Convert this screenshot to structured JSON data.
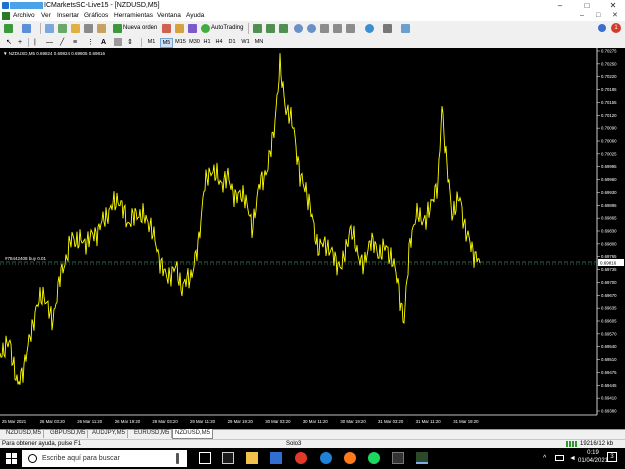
{
  "window": {
    "title": "ICMarketsSC-Live15 - [NZDUSD,M5]",
    "minimize_glyph": "–",
    "restore_glyph": "□",
    "close_glyph": "✕"
  },
  "menu": {
    "items": [
      "Archivo",
      "Ver",
      "Insertar",
      "Gráficos",
      "Herramientas",
      "Ventana",
      "Ayuda"
    ],
    "doc_controls": [
      "–",
      "□",
      "✕"
    ]
  },
  "toolbar": {
    "new_order_label": "Nueva orden",
    "autotrading_label": "AutoTrading",
    "alerts_count": "1"
  },
  "timeframes": [
    "M1",
    "M5",
    "M15",
    "M30",
    "H1",
    "H4",
    "D1",
    "W1",
    "MN"
  ],
  "chart": {
    "info_header": "▼ NZDUSD,M5  0.69824 0.69824 0.69805 0.69816",
    "order_label": "#78442408 buy 0.01",
    "current_price": "0.69816",
    "price_labels": [
      "0.70275",
      "0.70250",
      "0.70220",
      "0.70185",
      "0.70155",
      "0.70120",
      "0.70090",
      "0.70060",
      "0.70025",
      "0.69995",
      "0.69960",
      "0.69930",
      "0.69895",
      "0.69865",
      "0.69830",
      "0.69800",
      "0.69765",
      "0.69735",
      "0.69700",
      "0.69670",
      "0.69635",
      "0.69605",
      "0.69570",
      "0.69540",
      "0.69510",
      "0.69475",
      "0.69445",
      "0.69410",
      "0.69380"
    ],
    "time_labels": [
      "25 Mar 2021",
      "26 Mar 03:20",
      "26 Mar 11:20",
      "26 Mar 19:20",
      "29 Mar 03:20",
      "29 Mar 11:20",
      "29 Mar 19:20",
      "30 Mar 03:20",
      "30 Mar 11:20",
      "30 Mar 19:20",
      "31 Mar 03:20",
      "31 Mar 11:20",
      "31 Mar 19:20"
    ],
    "colors": {
      "background": "#000000",
      "candles": "#ffff00",
      "order_line": "#2e8b57",
      "bid_line": "#cccccc"
    }
  },
  "tabs": [
    "NZDUSD,M5",
    "GBPUSD,M5",
    "AUDJPY,M5",
    "EURUSD,M5",
    "NZDUSD,M5"
  ],
  "active_tab_index": 4,
  "status": {
    "help": "Para obtener ayuda, pulse F1",
    "profile": "Solo3",
    "traffic": "19216/12 kb"
  },
  "taskbar": {
    "search_placeholder": "Escribe aquí para buscar",
    "time": "0:19",
    "date": "01/04/2021",
    "notifications": "3"
  }
}
